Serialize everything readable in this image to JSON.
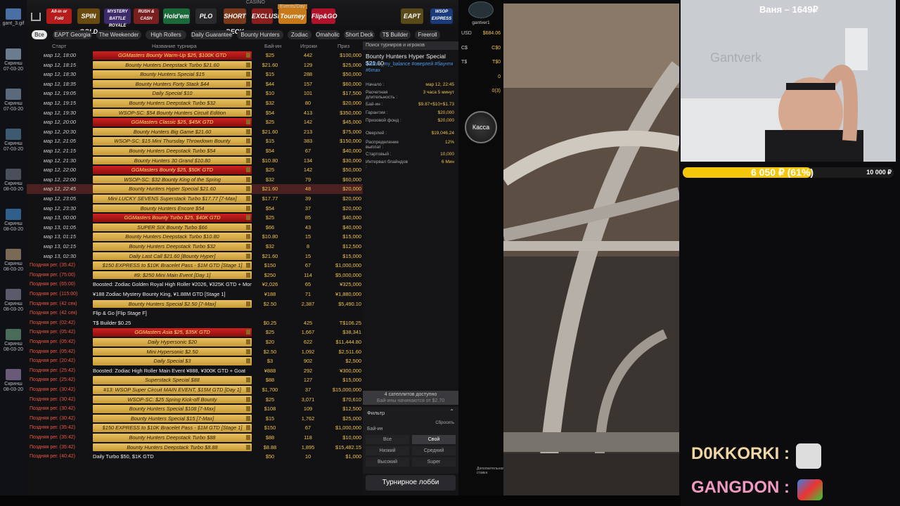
{
  "desktop": {
    "items": [
      "gant_3.gif",
      "Скринш 07-03-20",
      "Скринш 07-03-20",
      "Скринш 07-03-20",
      "Скринш 08-03-20",
      "Скринш 08-03-20",
      "Скринш 08-03-20",
      "Скринш 08-03-20",
      "Скринш 08-03-20",
      "Скринш 08-03-20"
    ]
  },
  "brands": [
    "All-in or Fold",
    "SPIN GOLD",
    "MYSTERY BATTLE ROYALE",
    "RUSH & CASH",
    "Hold'em",
    "PLO",
    "SHORT DECK",
    "EXCLUSIVE",
    "Tourney",
    "Flip&GO",
    "EAPT",
    "WSOP EXPRESS"
  ],
  "casino_label": "CASINO",
  "events_label": "Events/Day",
  "chips": [
    "Все",
    "EAPT Georgia",
    "The Weekender",
    "High Rollers",
    "Daily Guarantee",
    "Bounty Hunters",
    "Zodiac",
    "Omaholic",
    "Short Deck",
    "T$ Builder",
    "Freeroll"
  ],
  "columns": {
    "start": "Старт",
    "name": "Название турнира",
    "buyin": "Бай-ин",
    "players": "Игроки",
    "prize": "Приз"
  },
  "rows": [
    {
      "d": "мар 12, 18:00",
      "n": "GGMasters Bounty Warm-Up $25, $100K GTD",
      "b": "$25",
      "p": "442",
      "z": "$100,000",
      "t": "red"
    },
    {
      "d": "мар 12, 18:15",
      "n": "Bounty Hunters Deepstack Turbo $21.60",
      "b": "$21.60",
      "p": "129",
      "z": "$25,000",
      "t": "gold"
    },
    {
      "d": "мар 12, 18:30",
      "n": "Bounty Hunters Special $15",
      "b": "$15",
      "p": "288",
      "z": "$50,000",
      "t": "gold"
    },
    {
      "d": "мар 12, 18:35",
      "n": "Bounty Hunters Forty Stack $44",
      "b": "$44",
      "p": "157",
      "z": "$60,000",
      "t": "gold"
    },
    {
      "d": "мар 12, 19:05",
      "n": "Daily Special $10",
      "b": "$10",
      "p": "101",
      "z": "$17,500",
      "t": "gold"
    },
    {
      "d": "мар 12, 19:15",
      "n": "Bounty Hunters Deepstack Turbo $32",
      "b": "$32",
      "p": "80",
      "z": "$20,000",
      "t": "gold"
    },
    {
      "d": "мар 12, 19:30",
      "n": "WSOP-SC: $54 Bounty Hunters Circuit Edition",
      "b": "$54",
      "p": "413",
      "z": "$350,000",
      "t": "gold"
    },
    {
      "d": "мар 12, 20:00",
      "n": "GGMasters Classic $25, $45K GTD",
      "b": "$25",
      "p": "142",
      "z": "$45,000",
      "t": "red"
    },
    {
      "d": "мар 12, 20:30",
      "n": "Bounty Hunters Big Game $21.60",
      "b": "$21.60",
      "p": "213",
      "z": "$75,000",
      "t": "gold"
    },
    {
      "d": "мар 12, 21:05",
      "n": "WSOP-SC: $15 Mini Thursday Throwdown Bounty",
      "b": "$15",
      "p": "383",
      "z": "$150,000",
      "t": "gold"
    },
    {
      "d": "мар 12, 21:15",
      "n": "Bounty Hunters Deepstack Turbo $54",
      "b": "$54",
      "p": "67",
      "z": "$40,000",
      "t": "gold"
    },
    {
      "d": "мар 12, 21:30",
      "n": "Bounty Hunters 30 Grand $10.80",
      "b": "$10.80",
      "p": "134",
      "z": "$30,000",
      "t": "gold"
    },
    {
      "d": "мар 12, 22:00",
      "n": "GGMasters Bounty $25, $50K GTD",
      "b": "$25",
      "p": "142",
      "z": "$50,000",
      "t": "red"
    },
    {
      "d": "мар 12, 22:00",
      "n": "WSOP-SC: $32 Bounty King of the Spring",
      "b": "$32",
      "p": "79",
      "z": "$60,000",
      "t": "gold"
    },
    {
      "d": "мар 12, 22:45",
      "n": "Bounty Hunters Hyper Special $21.60",
      "b": "$21.60",
      "p": "48",
      "z": "$20,000",
      "t": "gold",
      "sel": true
    },
    {
      "d": "мар 12, 23:05",
      "n": "Mini LUCKY SEVENS Superstack Turbo $17.77 [7-Max]",
      "b": "$17.77",
      "p": "39",
      "z": "$20,000",
      "t": "gold"
    },
    {
      "d": "мар 12, 23:30",
      "n": "Bounty Hunters Encore $54",
      "b": "$54",
      "p": "37",
      "z": "$20,000",
      "t": "gold"
    },
    {
      "d": "мар 13, 00:00",
      "n": "GGMasters Bounty Turbo $25, $40K GTD",
      "b": "$25",
      "p": "85",
      "z": "$40,000",
      "t": "red"
    },
    {
      "d": "мар 13, 01:05",
      "n": "SUPER SIX Bounty Turbo $66",
      "b": "$66",
      "p": "43",
      "z": "$40,000",
      "t": "gold"
    },
    {
      "d": "мар 13, 01:15",
      "n": "Bounty Hunters Deepstack Turbo $10.80",
      "b": "$10.80",
      "p": "15",
      "z": "$15,000",
      "t": "gold"
    },
    {
      "d": "мар 13, 02:15",
      "n": "Bounty Hunters Deepstack Turbo $32",
      "b": "$32",
      "p": "8",
      "z": "$12,500",
      "t": "gold"
    },
    {
      "d": "мар 13, 02:30",
      "n": "Daily Last Call $21.60 [Bounty Hyper]",
      "b": "$21.60",
      "p": "15",
      "z": "$15,000",
      "t": "gold"
    },
    {
      "late": "Поздняя рег. (35:42)",
      "n": "$150 EXPRESS to $10K Bracelet Pass - $1M GTD [Stage 1]",
      "b": "$150",
      "p": "67",
      "z": "$1,000,000",
      "t": "gold"
    },
    {
      "late": "Поздняя рег. (75:00)",
      "n": "#9: $250 Mini Main Event [Day 1]",
      "b": "$250",
      "p": "114",
      "z": "$5,000,000",
      "t": "gold"
    },
    {
      "late": "Поздняя рег. (65:00)",
      "n": "Boosted: Zodiac Golden Royal High Roller ¥2026, ¥325K GTD + Monkey",
      "b": "¥2,026",
      "p": "65",
      "z": "¥325,000",
      "t": "plain"
    },
    {
      "late": "Поздняя рег. (115:00)",
      "n": "¥188 Zodiac Mystery Bounty King, ¥1.88M GTD [Stage 1]",
      "b": "¥188",
      "p": "71",
      "z": "¥1,880,000",
      "t": "plain"
    },
    {
      "late": "Поздняя рег. (42 сек)",
      "n": "Bounty Hunters Special $2.50 [7-Max]",
      "b": "$2.50",
      "p": "2,387",
      "z": "$5,490.10",
      "t": "gold"
    },
    {
      "late": "Поздняя рег. (42 сек)",
      "n": "Flip & Go [Flip Stage F]",
      "b": "",
      "p": "",
      "z": "",
      "t": "plain"
    },
    {
      "late": "Поздняя рег. (02:42)",
      "n": "T$ Builder $0.25",
      "b": "$0.25",
      "p": "425",
      "z": "T$106.25",
      "t": "plain"
    },
    {
      "late": "Поздняя рег. (05:42)",
      "n": "GGMasters Asia $25, $35K GTD",
      "b": "$25",
      "p": "1,667",
      "z": "$38,341",
      "t": "red"
    },
    {
      "late": "Поздняя рег. (05:42)",
      "n": "Daily Hypersonic $20",
      "b": "$20",
      "p": "622",
      "z": "$11,444.80",
      "t": "gold"
    },
    {
      "late": "Поздняя рег. (05:42)",
      "n": "Mini Hypersonic $2.50",
      "b": "$2.50",
      "p": "1,092",
      "z": "$2,511.60",
      "t": "gold"
    },
    {
      "late": "Поздняя рег. (20:42)",
      "n": "Daily Special $3",
      "b": "$3",
      "p": "902",
      "z": "$2,500",
      "t": "gold"
    },
    {
      "late": "Поздняя рег. (25:42)",
      "n": "Boosted: Zodiac High Roller Main Event ¥888, ¥300K GTD + Goat",
      "b": "¥888",
      "p": "292",
      "z": "¥300,000",
      "t": "plain"
    },
    {
      "late": "Поздняя рег. (25:42)",
      "n": "Superstack Special $88",
      "b": "$88",
      "p": "127",
      "z": "$15,000",
      "t": "gold"
    },
    {
      "late": "Поздняя рег. (30:42)",
      "n": "#13: WSOP Super Circuit MAIN EVENT, $15M GTD [Day 1]",
      "b": "$1,700",
      "p": "37",
      "z": "$15,000,000",
      "t": "gold"
    },
    {
      "late": "Поздняя рег. (30:42)",
      "n": "WSOP-SC: $25 Spring Kick-off Bounty",
      "b": "$25",
      "p": "3,071",
      "z": "$70,610",
      "t": "gold"
    },
    {
      "late": "Поздняя рег. (30:42)",
      "n": "Bounty Hunters Special $108 [7-Max]",
      "b": "$108",
      "p": "109",
      "z": "$12,500",
      "t": "gold"
    },
    {
      "late": "Поздняя рег. (30:42)",
      "n": "Bounty Hunters Special $15 [7-Max]",
      "b": "$15",
      "p": "1,762",
      "z": "$25,000",
      "t": "gold"
    },
    {
      "late": "Поздняя рег. (35:42)",
      "n": "$150 EXPRESS to $10K Bracelet Pass - $1M GTD [Stage 1]",
      "b": "$150",
      "p": "67",
      "z": "$1,000,000",
      "t": "gold"
    },
    {
      "late": "Поздняя рег. (35:42)",
      "n": "Bounty Hunters Deepstack Turbo $88",
      "b": "$88",
      "p": "118",
      "z": "$10,000",
      "t": "gold"
    },
    {
      "late": "Поздняя рег. (35:42)",
      "n": "Bounty Hunters Deepstack Turbo $8.88",
      "b": "$8.88",
      "p": "1,895",
      "z": "$15,482.15",
      "t": "gold"
    },
    {
      "late": "Поздняя рег. (40:42)",
      "n": "Daily Turbo $50, $1K GTD",
      "b": "$50",
      "p": "10",
      "z": "$1,000",
      "t": "plain"
    }
  ],
  "info": {
    "search": "Поиск турниров и игроков",
    "title": "Bounty Hunters Hyper Special $21.60",
    "tags": "#within_my_balance #оверлей #баунти #6max",
    "fields": [
      {
        "k": "Начало :",
        "v": "мар 12, 22:45"
      },
      {
        "k": "Расчетная длительность :",
        "v": "3 часа 5 минут"
      },
      {
        "k": "Бай-ин :",
        "v": "$9.87+$10+$1.73"
      },
      {
        "k": "Гарантия :",
        "v": "$20,000"
      },
      {
        "k": "Призовой фонд :",
        "v": "$20,000"
      },
      {
        "k": "Оверлей :",
        "v": "$19,046.24"
      },
      {
        "k": "Распределение выплат :",
        "v": "12%"
      },
      {
        "k": "Стартовый :",
        "v": "10,000"
      },
      {
        "k": "Интервал блайндов :",
        "v": "6 Мин"
      }
    ],
    "satellites": "4 сателлитов доступно",
    "satellites_sub": "Бай-ины начинаются от $2.70",
    "filter": "Фильтр",
    "buyin_label": "Бай-ин",
    "reset": "Сбросить",
    "buttons": [
      "Все",
      "Свой",
      "Низкий",
      "Средний",
      "Высокий",
      "Super"
    ],
    "lobby": "Турнирное лобби"
  },
  "side": {
    "user": "gantver1",
    "balance": [
      {
        "k": "USD",
        "v": "$684.06"
      },
      {
        "k": "C$",
        "v": "C$0"
      },
      {
        "k": "T$",
        "v": "T$0"
      },
      {
        "k": "",
        "v": "0"
      },
      {
        "k": "",
        "v": "0(3)"
      }
    ],
    "kassa": "Касса",
    "extra": "Дополнительная ставка"
  },
  "stream": {
    "name_goal": "Ваня – 1649₽",
    "donation": "6 050 ₽ (61%)",
    "donation_pct": 61,
    "goal": "10 000 ₽",
    "watermark": "Gantverk",
    "chat": [
      {
        "user": "D0KKORKI",
        "sep": ":"
      },
      {
        "user": "GANGDON",
        "sep": ":"
      }
    ]
  },
  "colors": {
    "gold": "#f0c24a",
    "red": "#c81818",
    "accent": "#f4c70a"
  }
}
